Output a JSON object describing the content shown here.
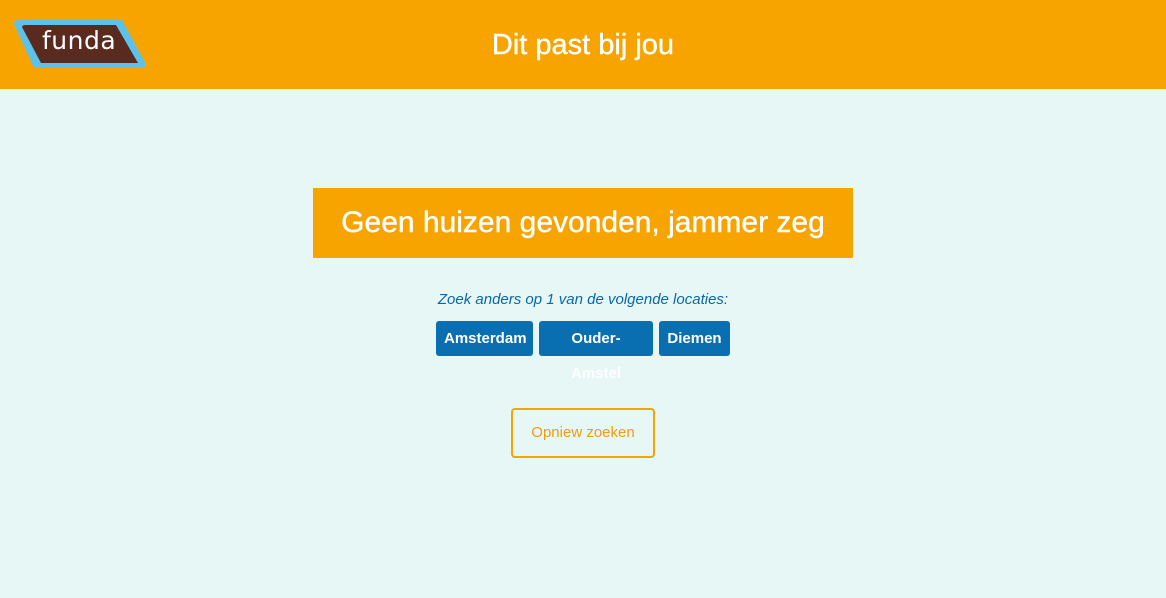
{
  "header": {
    "logo_text": "funda",
    "title": "Dit past bij jou"
  },
  "main": {
    "result_title": "Geen huizen gevonden, jammer zeg",
    "suggest_text": "Zoek anders op 1 van de volgende locaties:",
    "locations": [
      {
        "label": "Amsterdam"
      },
      {
        "label": "Ouder-Amstel"
      },
      {
        "label": "Diemen"
      }
    ],
    "retry_label": "Opniew zoeken"
  },
  "colors": {
    "header_bg": "#f7a400",
    "page_bg": "#e6f7f6",
    "location_button_bg": "#0a6fb0",
    "suggest_text": "#0a67a8",
    "logo_brown": "#5a2a1f",
    "logo_blue": "#5cc2ec"
  }
}
